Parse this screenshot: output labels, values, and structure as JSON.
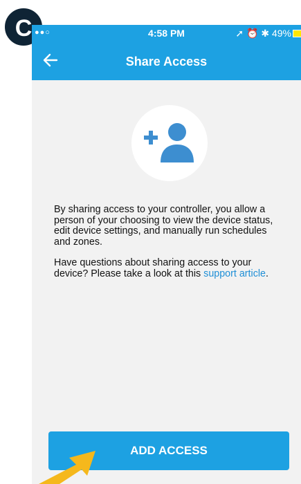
{
  "annotation": {
    "badge_letter": "C",
    "pointer_color": "#f5b81c"
  },
  "status_bar": {
    "signal": "●●○",
    "time": "4:58 PM",
    "indicators": "➚ ⏰ ✱ 49%",
    "battery_color": "#ffe600"
  },
  "header": {
    "title": "Share Access",
    "back_icon": "arrow-left-icon"
  },
  "main": {
    "illustration_icon": "add-person-icon",
    "paragraph1": "By sharing access to your controller, you allow a person of your choosing to view the device status, edit device settings, and manually run schedules and zones.",
    "paragraph2_prefix": "Have questions about sharing access to your device? Please take a look at this ",
    "paragraph2_link": "support article",
    "paragraph2_suffix": "."
  },
  "actions": {
    "add_access_label": "ADD ACCESS"
  },
  "colors": {
    "brand": "#1da1e2",
    "background": "#f2f2f2",
    "link": "#1f8fd6",
    "icon": "#3d8ed0"
  }
}
